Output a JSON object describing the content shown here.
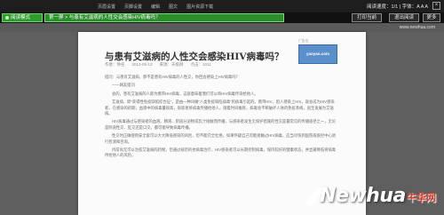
{
  "topbar": {
    "menu": [
      "页眉设置",
      "页脚设置",
      "编辑",
      "图文",
      "图片资源下载"
    ],
    "status": "阅读速度：1/1 | 字体：A A A"
  },
  "nav": {
    "logo_label": "阅读模式",
    "breadcrumb": "第一屏 > 与患有艾滋病的人性交会感染HIV病毒吗？",
    "btn_print": "打印当前",
    "btn_exit": "退出阅读",
    "btn_more": "更多"
  },
  "toolstrip": {
    "tools": "www.newhua.com"
  },
  "article": {
    "title": "与患有艾滋病的人性交会感染HIV病毒吗？",
    "meta": [
      "作者：佚名",
      "2012-05-13",
      "来源：天极网",
      "点击：1011"
    ],
    "ad_label": "广告位",
    "ad_brand": "yaoyan.com",
    "paragraphs": [
      "提问：与患有艾滋病，那不是患有HIV病毒的人性交，你回会感染上HIV病毒吗？",
      "——网友提问",
      "会的，患有艾滋病的人即为携带HIV病毒，这就意味着我们可以将HIV病毒传染给他人。",
      "艾滋病，即“获得性免疫缺陷综合征”，是由一种叫做“人类免疫缺陷病毒”的病毒引起的。携带HIV，因人感染上HIV，就会成为HIV感染者，在感染的初期，血液中的病毒量很高，很容易将病毒传播给他人。随着时间推移，病毒会不断破坏人体的免疫系统，直至发展为艾滋病。",
      "HIV病毒通过与感染者的血液、精液、阴道分泌物或乳汁接触而传播。与感染者发生无保护措施的性交是最常见的传播途径之一，无论是阴道性交、肛交还是口交，都可能导致病毒传播。",
      "性交时正确使用安全套可以大大降低感染的风险，但不能完全杜绝。如果怀疑自己可能接触过HIV病毒，应当尽快到医院或疾控中心进行检测和咨询。",
      "目前尚无可以治愈艾滋病的药物，但通过规范的抗病毒治疗，HIV感染者可以长期控制病毒，保持较好的健康状态，并显著降低将病毒传给他人的风险。"
    ]
  },
  "watermark": {
    "brand": "Newhua",
    "cn": "牛华网"
  },
  "colors": {
    "accent_green": "#2a8f2a",
    "watermark_red": "#e23b2a"
  }
}
